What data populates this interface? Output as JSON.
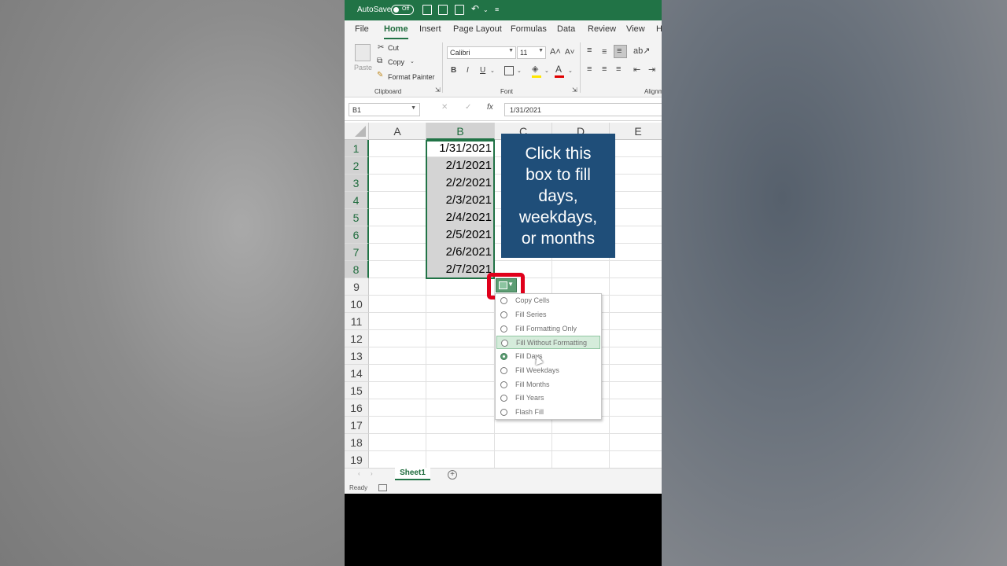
{
  "titlebar": {
    "autosave_label": "AutoSave",
    "autosave_state": "Off"
  },
  "ribbon": {
    "tabs": [
      "File",
      "Home",
      "Insert",
      "Page Layout",
      "Formulas",
      "Data",
      "Review",
      "View",
      "H"
    ],
    "active_tab": "Home",
    "clipboard": {
      "paste_label": "Paste",
      "cut_label": "Cut",
      "copy_label": "Copy",
      "format_painter_label": "Format Painter",
      "group_label": "Clipboard"
    },
    "font": {
      "font_name": "Calibri",
      "font_size": "11",
      "group_label": "Font",
      "bold": "B",
      "italic": "I",
      "underline": "U"
    },
    "alignment": {
      "group_label": "Alignm"
    }
  },
  "formula_bar": {
    "name_box": "B1",
    "fx_label": "fx",
    "value": "1/31/2021"
  },
  "sheet": {
    "columns": [
      "A",
      "B",
      "C",
      "D",
      "E"
    ],
    "rows": [
      "1",
      "2",
      "3",
      "4",
      "5",
      "6",
      "7",
      "8",
      "9",
      "10",
      "11",
      "12",
      "13",
      "14",
      "15",
      "16",
      "17",
      "18",
      "19"
    ],
    "column_b_values": [
      "1/31/2021",
      "2/1/2021",
      "2/2/2021",
      "2/3/2021",
      "2/4/2021",
      "2/5/2021",
      "2/6/2021",
      "2/7/2021"
    ]
  },
  "callout": {
    "lines": [
      "Click this",
      "box to fill",
      "days,",
      "weekdays,",
      "or months"
    ]
  },
  "autofill_menu": {
    "items": [
      {
        "label": "Copy Cells",
        "selected": false
      },
      {
        "label": "Fill Series",
        "selected": false
      },
      {
        "label": "Fill Formatting Only",
        "selected": false
      },
      {
        "label": "Fill Without Formatting",
        "selected": false
      },
      {
        "label": "Fill Days",
        "selected": true
      },
      {
        "label": "Fill Weekdays",
        "selected": false
      },
      {
        "label": "Fill Months",
        "selected": false
      },
      {
        "label": "Fill Years",
        "selected": false
      },
      {
        "label": "Flash Fill",
        "selected": false
      }
    ],
    "hovered_item": "Fill Without Formatting"
  },
  "sheet_tabs": {
    "active": "Sheet1",
    "add_label": "+"
  },
  "status": {
    "text": "Ready"
  },
  "colors": {
    "excel_green": "#217346",
    "callout_blue": "#1f4e79",
    "highlight_red": "#e0001b",
    "menu_hover": "#d5ecdb"
  }
}
